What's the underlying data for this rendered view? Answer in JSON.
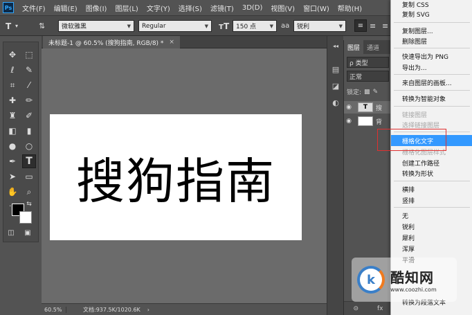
{
  "menubar": {
    "logo": "Ps",
    "items": [
      "文件(F)",
      "编辑(E)",
      "图像(I)",
      "图层(L)",
      "文字(Y)",
      "选择(S)",
      "滤镜(T)",
      "3D(D)",
      "视图(V)",
      "窗口(W)",
      "帮助(H)"
    ]
  },
  "options": {
    "font_family": "微软雅黑",
    "font_style": "Regular",
    "font_size": "150 点",
    "aa_label": "aa",
    "antialias": "锐利"
  },
  "document": {
    "tab_title": "未标题-1 @ 60.5% (搜狗指南, RGB/8) *",
    "close_glyph": "×",
    "text": "搜狗指南"
  },
  "status": {
    "zoom": "60.5%",
    "doc_size": "文档:937.5K/1020.6K"
  },
  "layers_panel": {
    "tabs": [
      "图层",
      "通道"
    ],
    "filter": "ρ 类型",
    "blend_mode": "正常",
    "lock_label": "锁定:",
    "layers": [
      {
        "thumb": "T",
        "name": "搜"
      },
      {
        "thumb": "",
        "name": "背"
      }
    ],
    "footer": [
      "⊝",
      "fx"
    ]
  },
  "context_menu": {
    "items": [
      {
        "label": "复制 CSS",
        "disabled": false
      },
      {
        "label": "复制 SVG",
        "disabled": false
      },
      {
        "label": "复制图层...",
        "disabled": false
      },
      {
        "label": "删除图层",
        "disabled": false
      },
      {
        "label": "快速导出为 PNG",
        "disabled": false
      },
      {
        "label": "导出为...",
        "disabled": false
      },
      {
        "label": "来自图层的画板...",
        "disabled": false
      },
      {
        "label": "转换为智能对象",
        "disabled": false
      },
      {
        "label": "链接图层",
        "disabled": true
      },
      {
        "label": "选择链接图层",
        "disabled": true
      },
      {
        "label": "栅格化文字",
        "disabled": false,
        "highlight": true
      },
      {
        "label": "栅格化图层样式",
        "disabled": true
      },
      {
        "label": "创建工作路径",
        "disabled": false
      },
      {
        "label": "转换为形状",
        "disabled": false
      },
      {
        "label": "横排",
        "disabled": false
      },
      {
        "label": "竖排",
        "disabled": false
      },
      {
        "label": "无",
        "disabled": false
      },
      {
        "label": "锐利",
        "disabled": false
      },
      {
        "label": "犀利",
        "disabled": false
      },
      {
        "label": "浑厚",
        "disabled": false
      },
      {
        "label": "平滑",
        "disabled": false
      },
      {
        "label": "转换为段落文本",
        "disabled": false
      }
    ]
  },
  "watermark": {
    "logo_letter": "k",
    "title": "酷知网",
    "url": "www.coozhi.com"
  },
  "colors": {
    "highlight": "#3399ff",
    "annotation": "#e03030",
    "foreground": "#000000",
    "background": "#ffffff"
  }
}
